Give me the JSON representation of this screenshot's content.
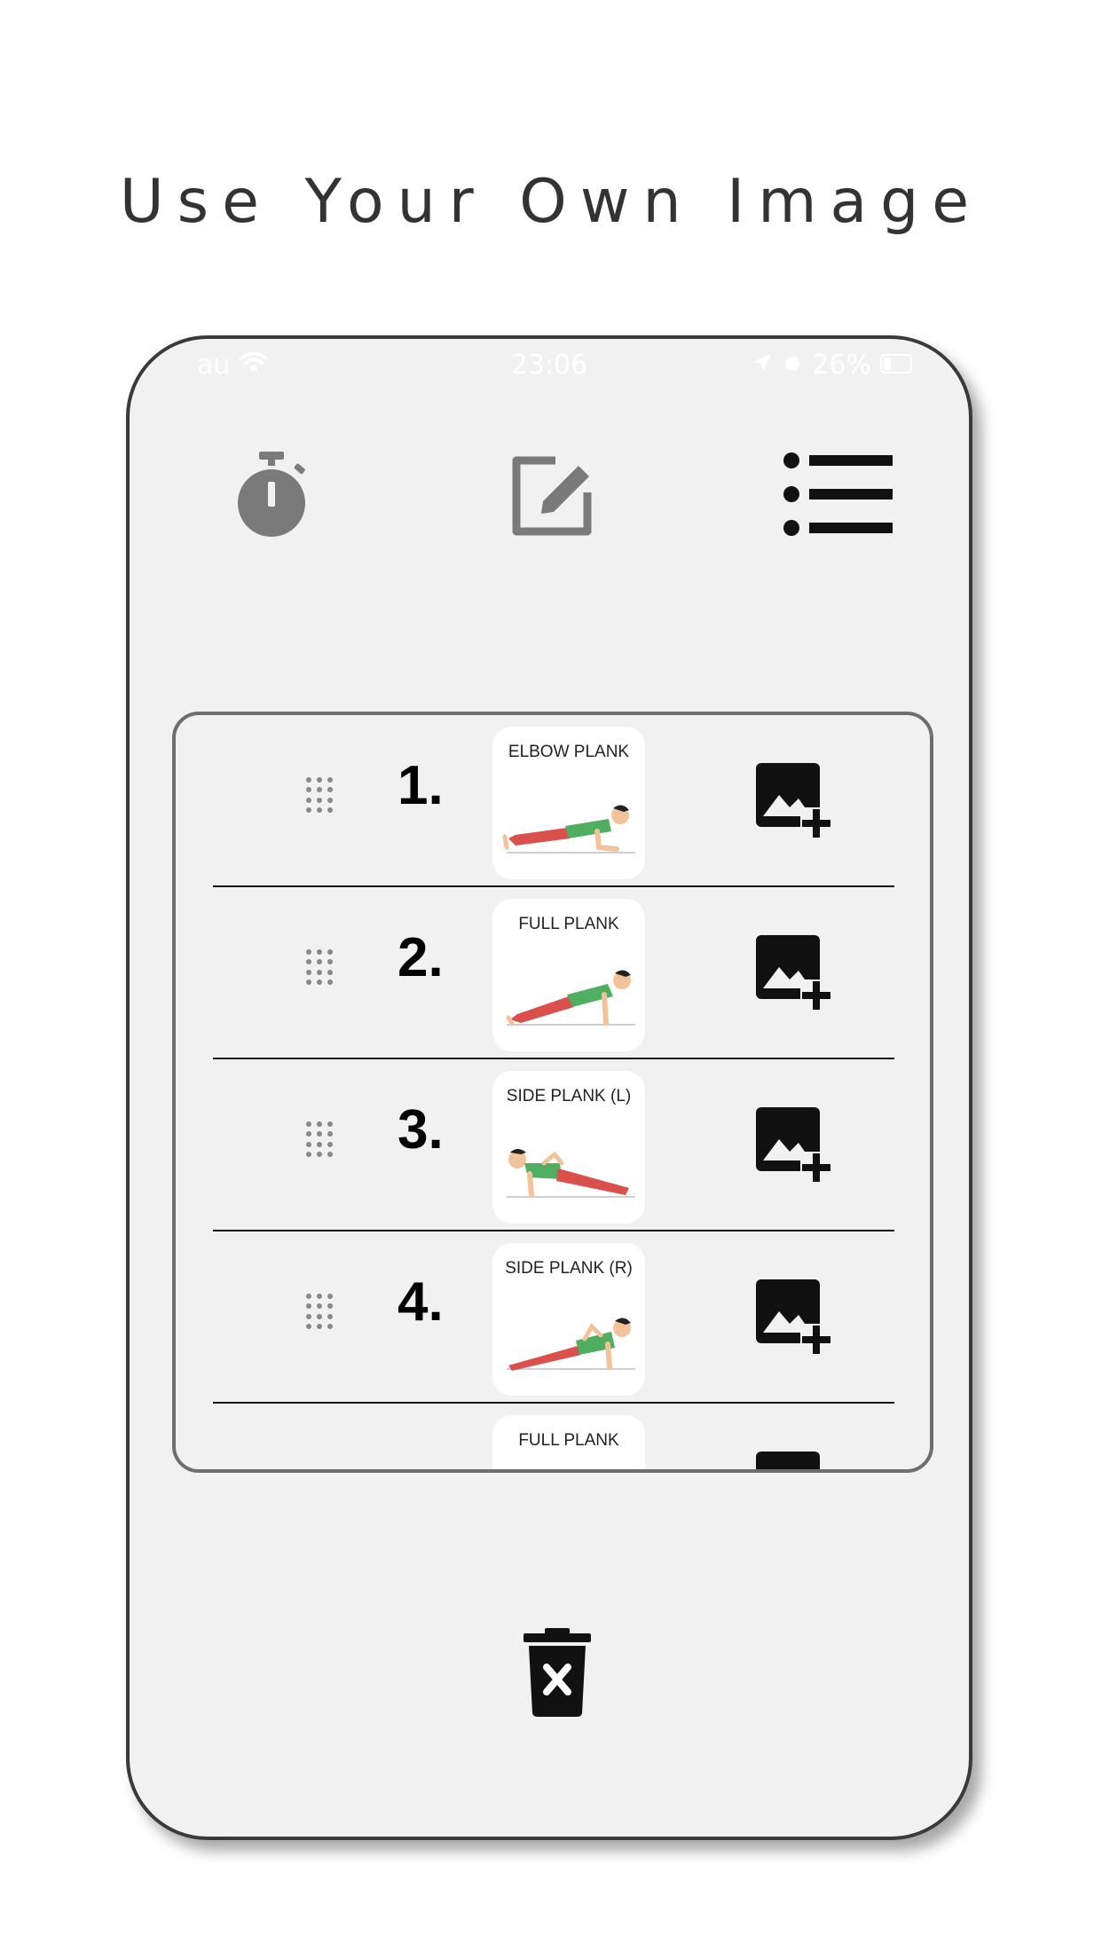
{
  "headline": "Use Your Own Image",
  "status_bar": {
    "carrier": "au",
    "time": "23:06",
    "battery": "26%"
  },
  "toolbar": {
    "timer_icon": "stopwatch-icon",
    "edit_icon": "edit-icon",
    "list_icon": "list-icon"
  },
  "exercises": [
    {
      "number": "1.",
      "title": "ELBOW PLANK"
    },
    {
      "number": "2.",
      "title": "FULL PLANK"
    },
    {
      "number": "3.",
      "title": "SIDE PLANK (L)"
    },
    {
      "number": "4.",
      "title": "SIDE PLANK (R)"
    },
    {
      "number": "",
      "title": "FULL PLANK"
    }
  ],
  "colors": {
    "icon_gray": "#7a7a7a",
    "icon_black": "#111111",
    "shirt_green": "#4fae5f",
    "pants_red": "#d9504c",
    "phone_bg": "#f1f1f1"
  },
  "footer": {
    "delete_icon": "trash-icon"
  }
}
